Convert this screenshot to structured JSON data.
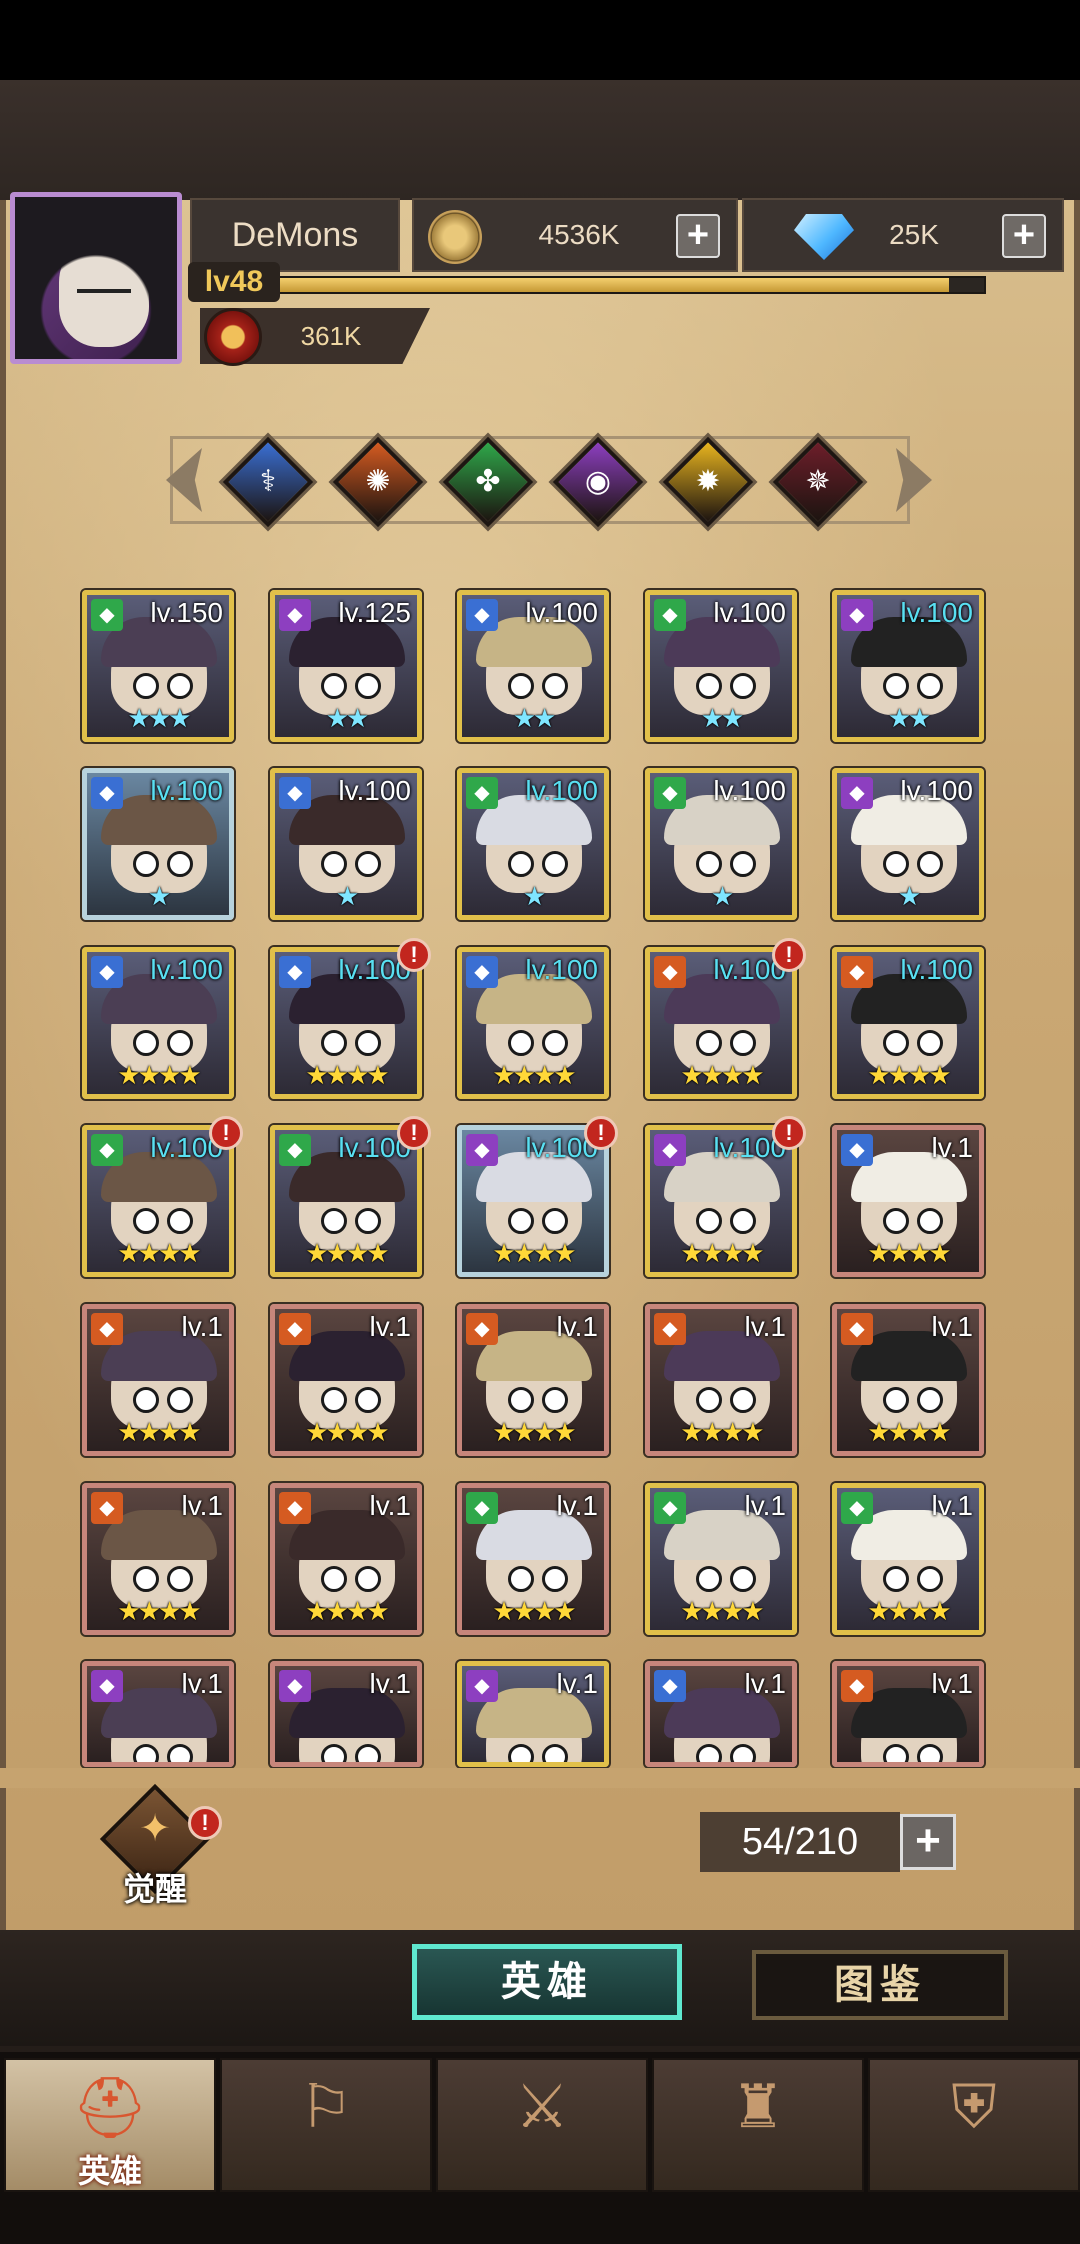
{
  "player": {
    "name": "DeMons",
    "level": "lv48",
    "xp_fraction": 0.95,
    "power": "361K"
  },
  "currency": {
    "gold": "4536K",
    "gems": "25K",
    "plus_symbol": "+"
  },
  "factions": [
    {
      "name": "light-faction",
      "color": "#3a6fd3",
      "symbol": "⚕"
    },
    {
      "name": "fire-faction",
      "color": "#d55b21",
      "symbol": "✺"
    },
    {
      "name": "nature-faction",
      "color": "#2fa84a",
      "symbol": "✤"
    },
    {
      "name": "arcane-faction",
      "color": "#8d3fc0",
      "symbol": "◉"
    },
    {
      "name": "holy-faction",
      "color": "#e8b41f",
      "symbol": "✹"
    },
    {
      "name": "shadow-faction",
      "color": "#6d1e2a",
      "symbol": "✵"
    }
  ],
  "heroes": [
    {
      "level": "lv.150",
      "stars": "★★★",
      "star_color": "blue",
      "frame": "gold",
      "lv_color": "white",
      "faction_color": "#2fa84a",
      "alert": false
    },
    {
      "level": "lv.125",
      "stars": "★★",
      "star_color": "blue",
      "frame": "gold",
      "lv_color": "white",
      "faction_color": "#8d3fc0",
      "alert": false
    },
    {
      "level": "lv.100",
      "stars": "★★",
      "star_color": "blue",
      "frame": "gold",
      "lv_color": "white",
      "faction_color": "#3a6fd3",
      "alert": false
    },
    {
      "level": "lv.100",
      "stars": "★★",
      "star_color": "blue",
      "frame": "gold",
      "lv_color": "white",
      "faction_color": "#2fa84a",
      "alert": false
    },
    {
      "level": "lv.100",
      "stars": "★★",
      "star_color": "blue",
      "frame": "gold",
      "lv_color": "cyan",
      "faction_color": "#8d3fc0",
      "alert": false
    },
    {
      "level": "lv.100",
      "stars": "★",
      "star_color": "blue",
      "frame": "blue",
      "lv_color": "cyan",
      "faction_color": "#3a6fd3",
      "alert": false
    },
    {
      "level": "lv.100",
      "stars": "★",
      "star_color": "blue",
      "frame": "gold",
      "lv_color": "white",
      "faction_color": "#3a6fd3",
      "alert": false
    },
    {
      "level": "lv.100",
      "stars": "★",
      "star_color": "blue",
      "frame": "gold",
      "lv_color": "cyan",
      "faction_color": "#2fa84a",
      "alert": false
    },
    {
      "level": "lv.100",
      "stars": "★",
      "star_color": "blue",
      "frame": "gold",
      "lv_color": "white",
      "faction_color": "#2fa84a",
      "alert": false
    },
    {
      "level": "lv.100",
      "stars": "★",
      "star_color": "blue",
      "frame": "gold",
      "lv_color": "white",
      "faction_color": "#8d3fc0",
      "alert": false
    },
    {
      "level": "lv.100",
      "stars": "★★★★",
      "star_color": "gold",
      "frame": "gold",
      "lv_color": "cyan",
      "faction_color": "#3a6fd3",
      "alert": false
    },
    {
      "level": "lv.100",
      "stars": "★★★★",
      "star_color": "gold",
      "frame": "gold",
      "lv_color": "cyan",
      "faction_color": "#3a6fd3",
      "alert": true
    },
    {
      "level": "lv.100",
      "stars": "★★★★",
      "star_color": "gold",
      "frame": "gold",
      "lv_color": "cyan",
      "faction_color": "#3a6fd3",
      "alert": false
    },
    {
      "level": "lv.100",
      "stars": "★★★★",
      "star_color": "gold",
      "frame": "gold",
      "lv_color": "cyan",
      "faction_color": "#d55b21",
      "alert": true
    },
    {
      "level": "lv.100",
      "stars": "★★★★",
      "star_color": "gold",
      "frame": "gold",
      "lv_color": "cyan",
      "faction_color": "#d55b21",
      "alert": false
    },
    {
      "level": "lv.100",
      "stars": "★★★★",
      "star_color": "gold",
      "frame": "gold",
      "lv_color": "cyan",
      "faction_color": "#2fa84a",
      "alert": true
    },
    {
      "level": "lv.100",
      "stars": "★★★★",
      "star_color": "gold",
      "frame": "gold",
      "lv_color": "cyan",
      "faction_color": "#2fa84a",
      "alert": true
    },
    {
      "level": "lv.100",
      "stars": "★★★★",
      "star_color": "gold",
      "frame": "blue",
      "lv_color": "cyan",
      "faction_color": "#8d3fc0",
      "alert": true
    },
    {
      "level": "lv.100",
      "stars": "★★★★",
      "star_color": "gold",
      "frame": "gold",
      "lv_color": "cyan",
      "faction_color": "#8d3fc0",
      "alert": true
    },
    {
      "level": "lv.1",
      "stars": "★★★★",
      "star_color": "gold",
      "frame": "brown",
      "lv_color": "white",
      "faction_color": "#3a6fd3",
      "alert": false
    },
    {
      "level": "lv.1",
      "stars": "★★★★",
      "star_color": "gold",
      "frame": "brown",
      "lv_color": "white",
      "faction_color": "#d55b21",
      "alert": false
    },
    {
      "level": "lv.1",
      "stars": "★★★★",
      "star_color": "gold",
      "frame": "brown",
      "lv_color": "white",
      "faction_color": "#d55b21",
      "alert": false
    },
    {
      "level": "lv.1",
      "stars": "★★★★",
      "star_color": "gold",
      "frame": "brown",
      "lv_color": "white",
      "faction_color": "#d55b21",
      "alert": false
    },
    {
      "level": "lv.1",
      "stars": "★★★★",
      "star_color": "gold",
      "frame": "brown",
      "lv_color": "white",
      "faction_color": "#d55b21",
      "alert": false
    },
    {
      "level": "lv.1",
      "stars": "★★★★",
      "star_color": "gold",
      "frame": "brown",
      "lv_color": "white",
      "faction_color": "#d55b21",
      "alert": false
    },
    {
      "level": "lv.1",
      "stars": "★★★★",
      "star_color": "gold",
      "frame": "brown",
      "lv_color": "white",
      "faction_color": "#d55b21",
      "alert": false
    },
    {
      "level": "lv.1",
      "stars": "★★★★",
      "star_color": "gold",
      "frame": "brown",
      "lv_color": "white",
      "faction_color": "#d55b21",
      "alert": false
    },
    {
      "level": "lv.1",
      "stars": "★★★★",
      "star_color": "gold",
      "frame": "brown",
      "lv_color": "white",
      "faction_color": "#2fa84a",
      "alert": false
    },
    {
      "level": "lv.1",
      "stars": "★★★★",
      "star_color": "gold",
      "frame": "gold",
      "lv_color": "white",
      "faction_color": "#2fa84a",
      "alert": false
    },
    {
      "level": "lv.1",
      "stars": "★★★★",
      "star_color": "gold",
      "frame": "gold",
      "lv_color": "white",
      "faction_color": "#2fa84a",
      "alert": false
    },
    {
      "level": "lv.1",
      "stars": "",
      "star_color": "gold",
      "frame": "brown",
      "lv_color": "white",
      "faction_color": "#8d3fc0",
      "alert": false
    },
    {
      "level": "lv.1",
      "stars": "",
      "star_color": "gold",
      "frame": "brown",
      "lv_color": "white",
      "faction_color": "#8d3fc0",
      "alert": false
    },
    {
      "level": "lv.1",
      "stars": "",
      "star_color": "gold",
      "frame": "gold",
      "lv_color": "white",
      "faction_color": "#8d3fc0",
      "alert": false
    },
    {
      "level": "lv.1",
      "stars": "",
      "star_color": "gold",
      "frame": "brown",
      "lv_color": "white",
      "faction_color": "#3a6fd3",
      "alert": false
    },
    {
      "level": "lv.1",
      "stars": "",
      "star_color": "gold",
      "frame": "brown",
      "lv_color": "white",
      "faction_color": "#d55b21",
      "alert": false
    }
  ],
  "alert_symbol": "!",
  "awaken": {
    "label": "觉醒",
    "icon": "awaken-icon"
  },
  "capacity": {
    "text": "54/210"
  },
  "tabs": {
    "heroes": "英雄",
    "codex": "图鉴"
  },
  "nav": [
    {
      "label": "英雄",
      "icon": "helmet-icon",
      "active": true
    },
    {
      "label": "",
      "icon": "map-icon",
      "active": false
    },
    {
      "label": "",
      "icon": "battle-icon",
      "active": false
    },
    {
      "label": "",
      "icon": "castle-icon",
      "active": false
    },
    {
      "label": "",
      "icon": "guild-icon",
      "active": false
    }
  ]
}
